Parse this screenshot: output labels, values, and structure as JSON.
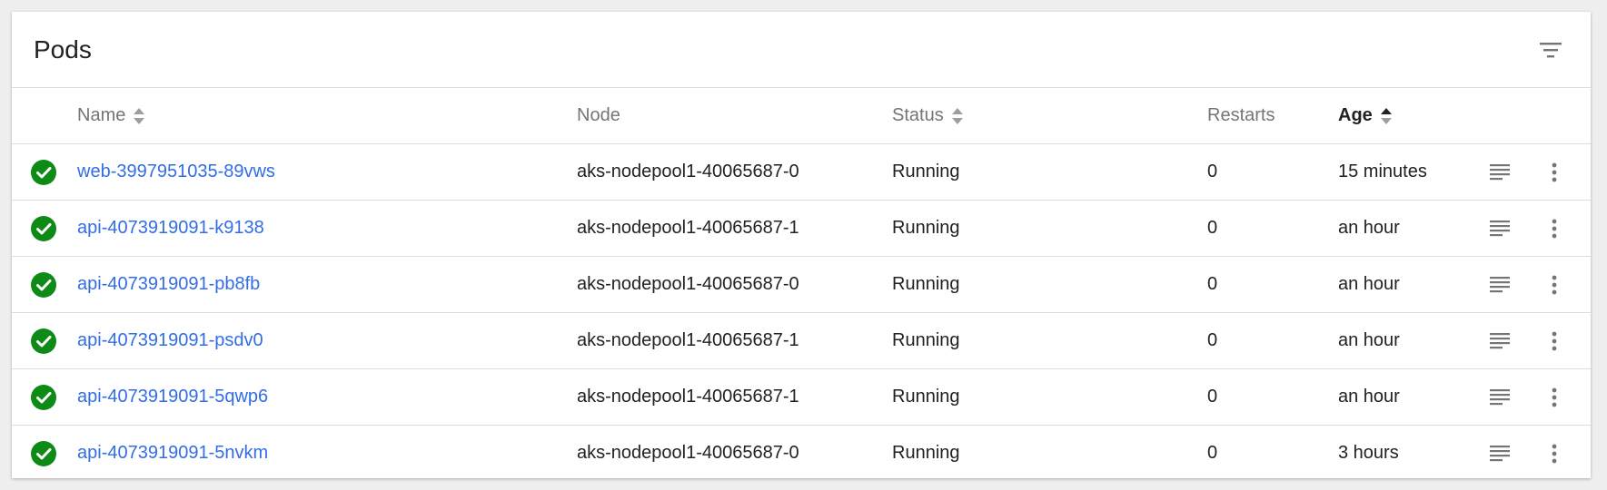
{
  "card": {
    "title": "Pods",
    "filter_icon": "filter-icon"
  },
  "table": {
    "columns": {
      "name": "Name",
      "node": "Node",
      "status": "Status",
      "restarts": "Restarts",
      "age": "Age"
    },
    "sort": {
      "active_column": "age",
      "sortable": [
        "name",
        "status",
        "age"
      ]
    },
    "rows": [
      {
        "status_icon": "check-circle-icon",
        "name": "web-3997951035-89vws",
        "node": "aks-nodepool1-40065687-0",
        "status": "Running",
        "restarts": "0",
        "age": "15 minutes"
      },
      {
        "status_icon": "check-circle-icon",
        "name": "api-4073919091-k9138",
        "node": "aks-nodepool1-40065687-1",
        "status": "Running",
        "restarts": "0",
        "age": "an hour"
      },
      {
        "status_icon": "check-circle-icon",
        "name": "api-4073919091-pb8fb",
        "node": "aks-nodepool1-40065687-0",
        "status": "Running",
        "restarts": "0",
        "age": "an hour"
      },
      {
        "status_icon": "check-circle-icon",
        "name": "api-4073919091-psdv0",
        "node": "aks-nodepool1-40065687-1",
        "status": "Running",
        "restarts": "0",
        "age": "an hour"
      },
      {
        "status_icon": "check-circle-icon",
        "name": "api-4073919091-5qwp6",
        "node": "aks-nodepool1-40065687-1",
        "status": "Running",
        "restarts": "0",
        "age": "an hour"
      },
      {
        "status_icon": "check-circle-icon",
        "name": "api-4073919091-5nvkm",
        "node": "aks-nodepool1-40065687-0",
        "status": "Running",
        "restarts": "0",
        "age": "3 hours"
      }
    ],
    "row_actions": {
      "logs_icon": "logs-icon",
      "menu_icon": "more-vert-icon"
    }
  },
  "colors": {
    "background": "#eeeeee",
    "card": "#ffffff",
    "link": "#326de6",
    "success": "#0e8a16",
    "header_text": "#757575",
    "icon": "#757575"
  }
}
